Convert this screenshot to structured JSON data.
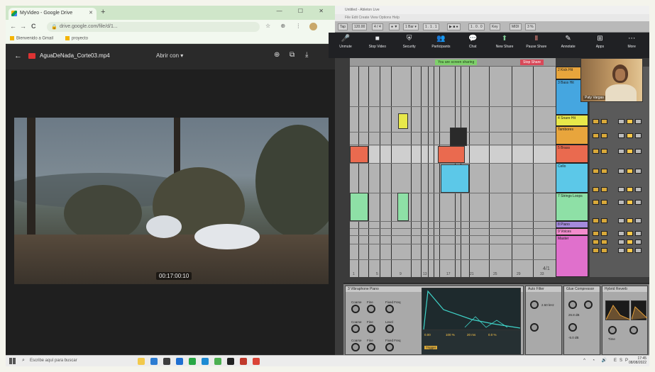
{
  "browser": {
    "tab_title": "MyVideo - Google Drive",
    "new_tab": "+",
    "window_controls": "— ☐ ✕",
    "url": "drive.google.com/file/d/1...",
    "bookmarks": [
      "Bienvenido a Gmail",
      "proyecto"
    ],
    "nav": {
      "back": "←",
      "forward": "→",
      "reload": "C"
    }
  },
  "drive_viewer": {
    "file_name": "AguaDeNada_Corte03.mp4",
    "open_with": "Abrir con",
    "open_with_caret": "▾",
    "timecode": "00:17:00:10"
  },
  "ableton": {
    "title": "Untitled - Ableton Live",
    "menu": "File  Edit  Create  View  Options  Help",
    "transport": [
      "Tap",
      "120.00",
      "4 / 4",
      "● ▼",
      "1 Bar ▾",
      "1 . 1 . 1",
      "▶ ■ ●",
      "1 . 0 . 0",
      "Key",
      "MIDI",
      "3 %"
    ],
    "arrangement_bars": [
      "1",
      "5",
      "9",
      "13",
      "17",
      "21",
      "25",
      "29",
      "33"
    ],
    "timestamp_bar": "4/1",
    "tracks": [
      {
        "name": "2 Kick Hit",
        "color": "#e8a53c"
      },
      {
        "name": "3 Bass Hit",
        "color": "#45a6e0"
      },
      {
        "name": "4 Snare Hit",
        "color": "#e8e84a"
      },
      {
        "name": "Tambores",
        "color": "#e8a53c"
      },
      {
        "name": "5 Brass",
        "color": "#ea6a4f"
      },
      {
        "name": "Cello",
        "color": "#5cc8e8"
      },
      {
        "name": "7 Strings Loops",
        "color": "#8ee0a6"
      },
      {
        "name": "8 Piano",
        "color": "#a48adc"
      },
      {
        "name": "9 Voices",
        "color": "#f38ccd"
      },
      {
        "name": "Master",
        "color": "#e070cc"
      }
    ],
    "devices": {
      "d1_title": "3 Vibraphone Piano",
      "d2_title": "Auto Filter",
      "d3_title": "Glue Compressor",
      "d4_title": "Hybrid Reverb",
      "knob_labels": [
        "Coarse",
        "Fine",
        "Fixed Freq",
        "Level",
        "Feedback",
        "Attack",
        "Decay",
        "Release",
        "Time"
      ],
      "values": [
        "0.00",
        "100 %",
        "26.8 dB",
        "2.50 kHz",
        "-5.0 dB",
        "20 ms",
        "0.0 %",
        "Trigger"
      ]
    }
  },
  "meet": {
    "controls": [
      {
        "icon": "🎤",
        "label": "Unmute"
      },
      {
        "icon": "■",
        "label": "Stop Video"
      },
      {
        "icon": "⛨",
        "label": "Security"
      },
      {
        "icon": "👥",
        "label": "Participants"
      },
      {
        "icon": "💬",
        "label": "Chat"
      },
      {
        "icon": "⬆",
        "label": "New Share"
      },
      {
        "icon": "Ⅱ",
        "label": "Pause Share"
      },
      {
        "icon": "✎",
        "label": "Annotate"
      },
      {
        "icon": "⊞",
        "label": "Apps"
      },
      {
        "icon": "⋯",
        "label": "More"
      }
    ],
    "sharing_text": "You are screen sharing",
    "stop_share": "Stop Share",
    "participant_name": "Paty Vargas"
  },
  "taskbar": {
    "search_placeholder": "Escribe aquí para buscar",
    "tray": "^ ◔ 🔊 ESP",
    "time": "17:45",
    "date": "08/08/2022",
    "apps": [
      "#f2c94c",
      "#2d7dd2",
      "#3d3d3d",
      "#1f6fd1",
      "#28a745",
      "#1d8bd3",
      "#4caf50",
      "#222",
      "#c0392b",
      "#db4437"
    ]
  },
  "colors": {
    "brand_drive": "#d33",
    "meet_share": "#81c995",
    "stop_red": "#d84858"
  }
}
